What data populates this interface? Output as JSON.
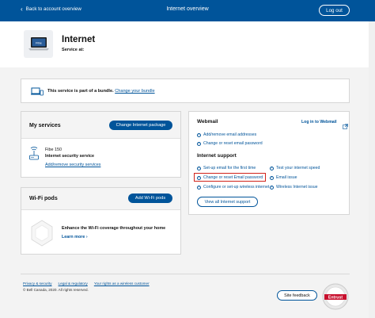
{
  "header": {
    "back_label": "Back to account overview",
    "title": "Internet overview",
    "logout_label": "Log out"
  },
  "hero": {
    "badge": "Fibe",
    "name": "Internet",
    "service_at": "Service at:"
  },
  "bundle": {
    "text": "This service is part of a bundle.",
    "link": "Change your bundle"
  },
  "my_services": {
    "title": "My services",
    "button": "Change Internet package",
    "plan_name": "Fibe 150",
    "plan_sub": "Internet security service",
    "security_link": "Add/remove security services"
  },
  "wifi_pods": {
    "title": "Wi-Fi pods",
    "button": "Add Wi-Fi pods",
    "text": "Enhance the Wi-Fi coverage throughout your home",
    "learn_more": "Learn more"
  },
  "webmail": {
    "title": "Webmail",
    "login_link": "Log in to Webmail",
    "links": [
      "Add/remove email addresses",
      "Change or reset email password"
    ]
  },
  "support": {
    "title": "Internet support",
    "left_links": [
      "Set-up email for the first time",
      "Change or reset Email password",
      "Configure or set-up wireless internet"
    ],
    "right_links": [
      "Test your internet speed",
      "Email issue",
      "Wireless Internet issue"
    ],
    "button": "View all Internet support"
  },
  "footer": {
    "links": [
      "Privacy & security",
      "Legal & regulatory",
      "Your rights as a wireless customer"
    ],
    "copyright": "© Bell Canada, 2020. All rights reserved.",
    "feedback": "Site feedback",
    "seal_text": "Entrust"
  },
  "colors": {
    "brand": "#00549a",
    "highlight": "#d0231a"
  }
}
